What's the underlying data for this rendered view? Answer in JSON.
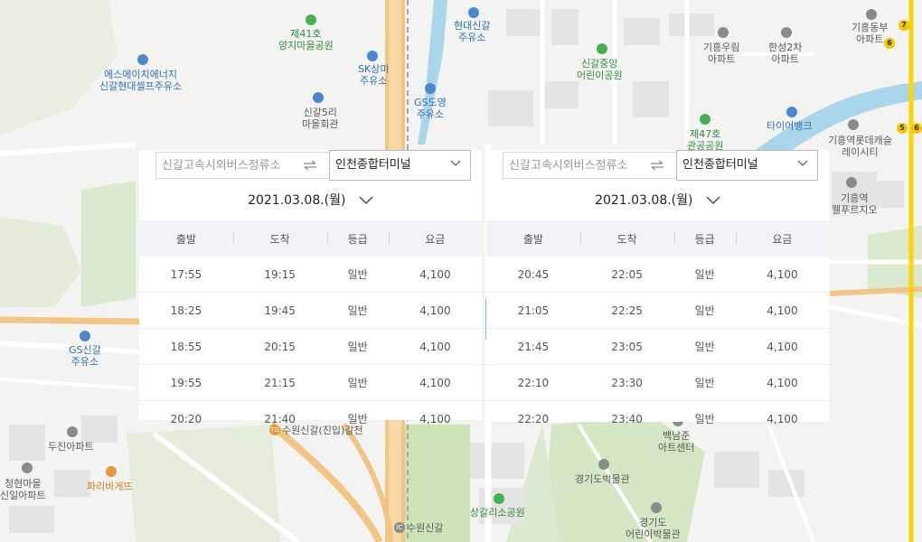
{
  "map": {
    "labels": [
      {
        "id": "yangji",
        "lines": [
          "제41호",
          "양지마을공원"
        ],
        "color": "green"
      },
      {
        "id": "sk",
        "lines": [
          "SK상미",
          "주유소"
        ],
        "color": "blue"
      },
      {
        "id": "hyundai",
        "lines": [
          "현대신갈",
          "주유소"
        ],
        "color": "blue"
      },
      {
        "id": "sincheon",
        "lines": [
          "신갈중앙",
          "어린이공원"
        ],
        "color": "green"
      },
      {
        "id": "giheung-woorim",
        "lines": [
          "기흥우림",
          "아파트"
        ],
        "color": "gray"
      },
      {
        "id": "hansung",
        "lines": [
          "한성2차",
          "아파트"
        ],
        "color": "gray"
      },
      {
        "id": "giheung-dongbu",
        "lines": [
          "기흥동부",
          "아파트"
        ],
        "color": "gray"
      },
      {
        "id": "s-energy",
        "lines": [
          "에스에이치에너지",
          "신갈현대셀프주유소"
        ],
        "color": "blue"
      },
      {
        "id": "singal5",
        "lines": [
          "신갈5리",
          "마을회관"
        ],
        "color": "gray"
      },
      {
        "id": "gs-do",
        "lines": [
          "GS도영",
          "주유소"
        ],
        "color": "blue"
      },
      {
        "id": "park47",
        "lines": [
          "제47호",
          "관공공원"
        ],
        "color": "green"
      },
      {
        "id": "tirebank",
        "lines": [
          "타이어뱅크"
        ],
        "color": "blue"
      },
      {
        "id": "lotte-castle",
        "lines": [
          "기흥역롯데캐슬",
          "레이시티"
        ],
        "color": "gray"
      },
      {
        "id": "prugio",
        "lines": [
          "기흥역",
          "웰푸르지오"
        ],
        "color": "gray"
      },
      {
        "id": "gs-singal",
        "lines": [
          "GS신갈",
          "주유소"
        ],
        "color": "blue"
      },
      {
        "id": "dujin",
        "lines": [
          "두진아파트"
        ],
        "color": "gray"
      },
      {
        "id": "cheonghyeon",
        "lines": [
          "청현마을",
          "신일아파트"
        ],
        "color": "gray"
      },
      {
        "id": "paris",
        "lines": [
          "파리바게뜨"
        ],
        "color": "orange"
      },
      {
        "id": "suwon-ic",
        "lines": [
          "수원신갈(진입)갈천"
        ],
        "color": "gray"
      },
      {
        "id": "baeknamjun",
        "lines": [
          "백남준",
          "아트센터"
        ],
        "color": "gray"
      },
      {
        "id": "gg-museum",
        "lines": [
          "경기도박물관"
        ],
        "color": "gray"
      },
      {
        "id": "sanggalriso",
        "lines": [
          "상갈리소공원"
        ],
        "color": "green"
      },
      {
        "id": "gg-children",
        "lines": [
          "경기도",
          "어린이박물관"
        ],
        "color": "gray"
      },
      {
        "id": "suwon-singal",
        "lines": [
          "수원신갈"
        ],
        "color": "gray"
      }
    ]
  },
  "panels": [
    {
      "from_placeholder": "신갈고속시외버스정류소",
      "to_value": "인천종합터미널",
      "date": "2021.03.08.(월)",
      "headers": [
        "출발",
        "도착",
        "등급",
        "요금"
      ],
      "rows": [
        [
          "17:55",
          "19:15",
          "일반",
          "4,100"
        ],
        [
          "18:25",
          "19:45",
          "일반",
          "4,100"
        ],
        [
          "18:55",
          "20:15",
          "일반",
          "4,100"
        ],
        [
          "19:55",
          "21:15",
          "일반",
          "4,100"
        ],
        [
          "20:20",
          "21:40",
          "일반",
          "4,100"
        ]
      ]
    },
    {
      "from_placeholder": "신갈고속시외버스정류소",
      "to_value": "인천종합터미널",
      "date": "2021.03.08.(월)",
      "headers": [
        "출발",
        "도착",
        "등급",
        "요금"
      ],
      "rows": [
        [
          "20:45",
          "22:05",
          "일반",
          "4,100"
        ],
        [
          "21:05",
          "22:25",
          "일반",
          "4,100"
        ],
        [
          "21:45",
          "23:05",
          "일반",
          "4,100"
        ],
        [
          "22:10",
          "23:30",
          "일반",
          "4,100"
        ],
        [
          "22:20",
          "23:40",
          "일반",
          "4,100"
        ]
      ]
    }
  ],
  "subway_badges": [
    "7",
    "6",
    "5",
    "6"
  ]
}
